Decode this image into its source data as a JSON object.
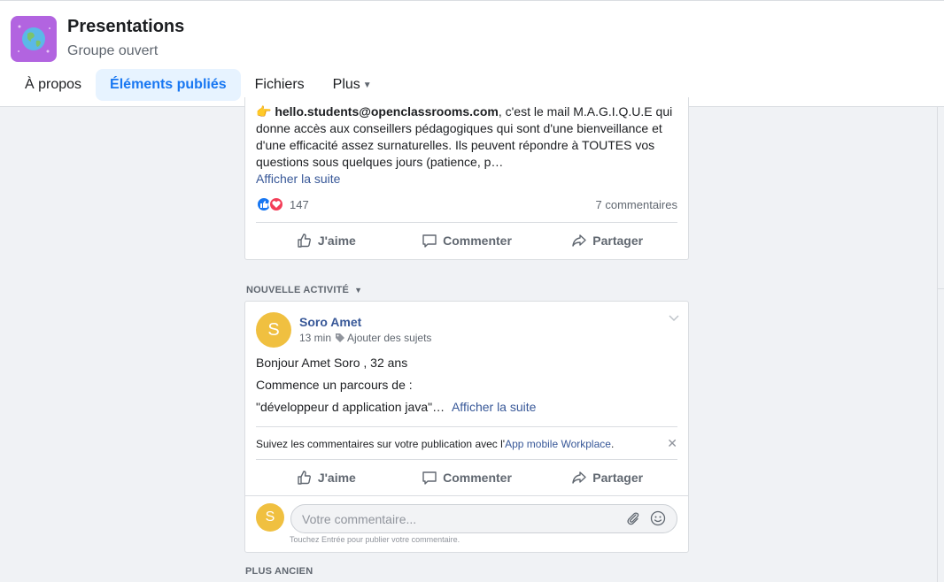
{
  "group": {
    "title": "Presentations",
    "subtitle": "Groupe ouvert"
  },
  "tabs": [
    {
      "label": "À propos",
      "active": false
    },
    {
      "label": "Éléments publiés",
      "active": true
    },
    {
      "label": "Fichiers",
      "active": false
    },
    {
      "label": "Plus",
      "active": false
    }
  ],
  "post1": {
    "email": "hello.students@openclassrooms.com",
    "text_after_email": ", c'est le mail M.A.G.I.Q.U.E qui donne accès aux conseillers pédagogiques qui sont d'une bienveillance et d'une efficacité assez surnaturelles. Ils peuvent répondre à TOUTES vos questions sous quelques jours (patience, p…",
    "see_more": "Afficher la suite",
    "reaction_count": "147",
    "comment_count": "7 commentaires"
  },
  "actions": {
    "like": "J'aime",
    "comment": "Commenter",
    "share": "Partager"
  },
  "section_new": "NOUVELLE ACTIVITÉ",
  "section_old": "PLUS ANCIEN",
  "post2": {
    "avatar_letter": "S",
    "author": "Soro Amet",
    "time": "13 min",
    "topics": "Ajouter des sujets",
    "line1": "Bonjour Amet Soro , 32 ans",
    "line2": "Commence un parcours de :",
    "line3": "\"développeur d application java\"…",
    "see_more": "Afficher la suite",
    "notice_prefix": "Suivez les commentaires sur votre publication avec l'",
    "notice_link": "App mobile Workplace",
    "notice_suffix": ".",
    "comment_placeholder": "Votre commentaire...",
    "comment_hint": "Touchez Entrée pour publier votre commentaire."
  },
  "colors": {
    "accent": "#1877f2",
    "link": "#385898",
    "avatar": "#f0c040"
  }
}
